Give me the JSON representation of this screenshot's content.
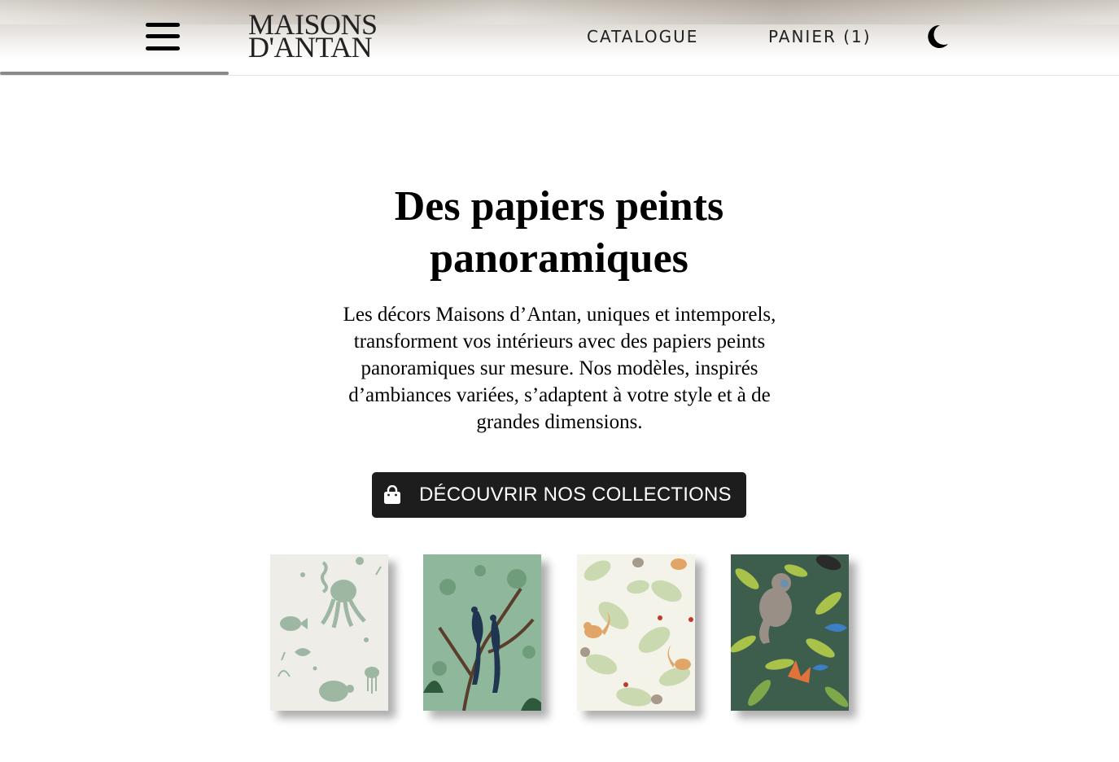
{
  "header": {
    "logo_line1": "MAISONS",
    "logo_line2": "D'ANTAN",
    "nav": {
      "catalogue": "CATALOGUE",
      "cart": "PANIER (1)"
    },
    "menu_icon": "hamburger-menu-icon",
    "theme_icon": "moon-icon"
  },
  "hero": {
    "title_line1": "Des papiers peints",
    "title_line2": "panoramiques",
    "description_lines": [
      "Les décors Maisons d’Antan, uniques et intemporels,",
      "transforment vos intérieurs avec des papiers peints",
      "panoramiques sur mesure. Nos modèles, inspirés",
      "d’ambiances variées, s’adaptent à votre style et à de",
      "grandes dimensions."
    ],
    "cta_label": "DÉCOUVRIR NOS COLLECTIONS",
    "cta_icon": "shopping-bag-icon"
  },
  "colors": {
    "cta_background": "#1d1d1d",
    "progress_bar": "#8a8a8a"
  },
  "thumbnails": [
    {
      "name": "ocean-wallpaper",
      "theme": "sea creatures"
    },
    {
      "name": "peacock-wallpaper",
      "theme": "birds on green"
    },
    {
      "name": "squirrel-wallpaper",
      "theme": "squirrels and leaves"
    },
    {
      "name": "jungle-monkey-wallpaper",
      "theme": "monkey in jungle"
    }
  ]
}
